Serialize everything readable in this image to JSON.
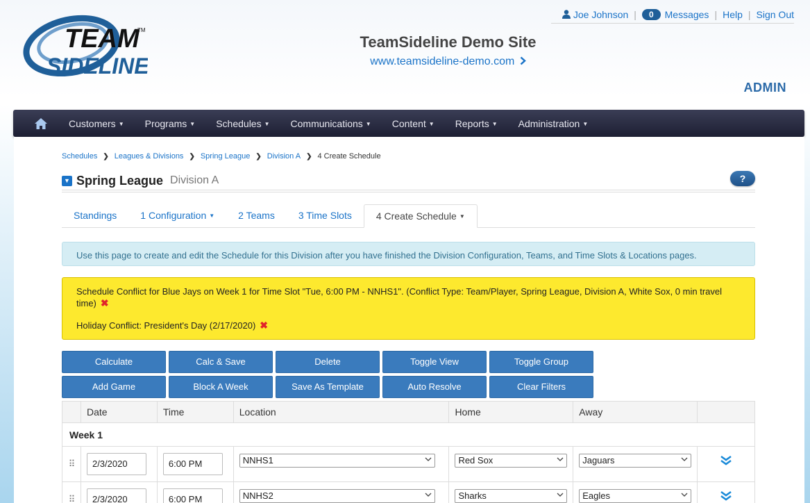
{
  "header": {
    "user_name": "Joe Johnson",
    "messages_count": "0",
    "messages_label": "Messages",
    "help_label": "Help",
    "signout_label": "Sign Out",
    "site_title": "TeamSideline Demo Site",
    "site_url": "www.teamsideline-demo.com",
    "role": "ADMIN"
  },
  "logo": {
    "line1": "TEAM",
    "line2": "SIDELINE",
    "tm": "TM"
  },
  "nav": {
    "items": [
      "Customers",
      "Programs",
      "Schedules",
      "Communications",
      "Content",
      "Reports",
      "Administration"
    ]
  },
  "breadcrumb": {
    "items": [
      "Schedules",
      "Leagues & Divisions",
      "Spring League",
      "Division A"
    ],
    "current": "4 Create Schedule"
  },
  "page": {
    "league": "Spring League",
    "division": "Division A",
    "help": "?"
  },
  "tabs": [
    "Standings",
    "1 Configuration",
    "2 Teams",
    "3 Time Slots",
    "4 Create Schedule"
  ],
  "info_text": "Use this page to create and edit the Schedule for this Division after you have finished the Division Configuration, Teams, and Time Slots & Locations pages.",
  "warnings": [
    "Schedule Conflict for Blue Jays on Week 1 for Time Slot \"Tue, 6:00 PM - NNHS1\". (Conflict Type: Team/Player, Spring League, Division A, White Sox, 0 min travel time)",
    "Holiday Conflict: President's Day (2/17/2020)"
  ],
  "buttons": {
    "row1": [
      "Calculate",
      "Calc & Save",
      "Delete",
      "Toggle View",
      "Toggle Group"
    ],
    "row2": [
      "Add Game",
      "Block A Week",
      "Save As Template",
      "Auto Resolve",
      "Clear Filters"
    ]
  },
  "grid": {
    "columns": [
      "Date",
      "Time",
      "Location",
      "Home",
      "Away"
    ],
    "week_label": "Week 1",
    "rows": [
      {
        "date": "2/3/2020",
        "time": "6:00 PM",
        "location": "NNHS1",
        "home": "Red Sox",
        "away": "Jaguars"
      },
      {
        "date": "2/3/2020",
        "time": "6:00 PM",
        "location": "NNHS2",
        "home": "Sharks",
        "away": "Eagles"
      }
    ]
  },
  "colors": {
    "accent": "#1a73c8",
    "nav_bg": "#1d1f33",
    "button": "#3a7bbd",
    "warning": "#fde92e",
    "info": "#d5edf4",
    "danger": "#e0242b"
  }
}
